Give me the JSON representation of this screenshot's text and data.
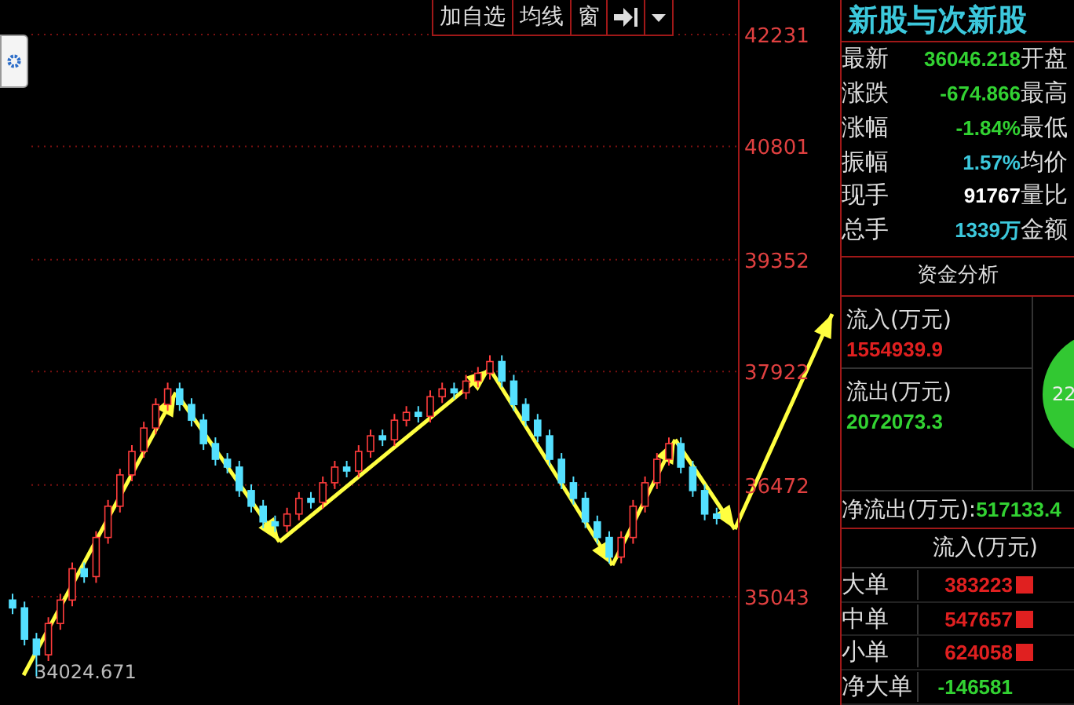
{
  "toolbar": {
    "buttons": [
      "加自选",
      "均线",
      "窗"
    ]
  },
  "chart": {
    "low_label": "34024.671",
    "chart_data": {
      "type": "candlestick",
      "grid": true,
      "ylim": [
        33658,
        42673
      ],
      "yticks": [
        42231,
        40801,
        39352,
        37922,
        36472,
        35043
      ],
      "ohlc": [
        [
          35000,
          35080,
          34820,
          34900
        ],
        [
          34900,
          34980,
          34420,
          34500
        ],
        [
          34500,
          34580,
          34024,
          34300
        ],
        [
          34300,
          34780,
          34220,
          34700
        ],
        [
          34700,
          35080,
          34620,
          35000
        ],
        [
          35000,
          35480,
          34920,
          35400
        ],
        [
          35400,
          35480,
          35220,
          35300
        ],
        [
          35300,
          35880,
          35220,
          35800
        ],
        [
          35800,
          36280,
          35720,
          36200
        ],
        [
          36200,
          36680,
          36120,
          36600
        ],
        [
          36600,
          36980,
          36520,
          36900
        ],
        [
          36900,
          37280,
          36820,
          37200
        ],
        [
          37200,
          37580,
          37120,
          37500
        ],
        [
          37500,
          37780,
          37420,
          37700
        ],
        [
          37700,
          37780,
          37420,
          37500
        ],
        [
          37500,
          37580,
          37220,
          37300
        ],
        [
          37300,
          37380,
          36920,
          37000
        ],
        [
          37000,
          37080,
          36720,
          36800
        ],
        [
          36800,
          36880,
          36620,
          36700
        ],
        [
          36700,
          36780,
          36320,
          36400
        ],
        [
          36400,
          36480,
          36120,
          36200
        ],
        [
          36200,
          36280,
          35920,
          36000
        ],
        [
          36000,
          36080,
          35870,
          35950
        ],
        [
          35950,
          36180,
          35870,
          36100
        ],
        [
          36100,
          36380,
          36020,
          36300
        ],
        [
          36300,
          36380,
          36170,
          36250
        ],
        [
          36250,
          36580,
          36170,
          36500
        ],
        [
          36500,
          36780,
          36420,
          36700
        ],
        [
          36700,
          36780,
          36570,
          36650
        ],
        [
          36650,
          36980,
          36570,
          36900
        ],
        [
          36900,
          37180,
          36820,
          37100
        ],
        [
          37100,
          37180,
          36970,
          37050
        ],
        [
          37050,
          37380,
          36970,
          37300
        ],
        [
          37300,
          37480,
          37220,
          37400
        ],
        [
          37400,
          37480,
          37270,
          37350
        ],
        [
          37350,
          37680,
          37270,
          37600
        ],
        [
          37600,
          37780,
          37520,
          37700
        ],
        [
          37700,
          37780,
          37570,
          37650
        ],
        [
          37650,
          37880,
          37570,
          37800
        ],
        [
          37800,
          37980,
          37720,
          37900
        ],
        [
          37900,
          38130,
          37820,
          38050
        ],
        [
          38050,
          38130,
          37720,
          37800
        ],
        [
          37800,
          37880,
          37420,
          37500
        ],
        [
          37500,
          37580,
          37220,
          37300
        ],
        [
          37300,
          37380,
          37020,
          37100
        ],
        [
          37100,
          37180,
          36720,
          36800
        ],
        [
          36800,
          36880,
          36420,
          36500
        ],
        [
          36500,
          36580,
          36220,
          36300
        ],
        [
          36300,
          36380,
          35920,
          36000
        ],
        [
          36000,
          36080,
          35720,
          35800
        ],
        [
          35800,
          35880,
          35470,
          35550
        ],
        [
          35550,
          35880,
          35470,
          35800
        ],
        [
          35800,
          36280,
          35720,
          36200
        ],
        [
          36200,
          36580,
          36120,
          36500
        ],
        [
          36500,
          36880,
          36420,
          36800
        ],
        [
          36800,
          37080,
          36720,
          37000
        ],
        [
          37000,
          37080,
          36620,
          36700
        ],
        [
          36700,
          36780,
          36320,
          36400
        ],
        [
          36400,
          36480,
          36020,
          36100
        ],
        [
          36100,
          36180,
          35966,
          36046
        ]
      ]
    }
  },
  "quote_panel": {
    "title": "新股与次新股",
    "rows": [
      {
        "label": "最新",
        "value": "36046.218",
        "color": "#32d232",
        "label2": "开盘"
      },
      {
        "label": "涨跌",
        "value": "-674.866",
        "color": "#32d232",
        "label2": "最高"
      },
      {
        "label": "涨幅",
        "value": "-1.84%",
        "color": "#32d232",
        "label2": "最低"
      },
      {
        "label": "振幅",
        "value": "1.57%",
        "color": "#3cc8dc",
        "label2": "均价"
      },
      {
        "label": "现手",
        "value": "91767",
        "color": "#ffffff",
        "label2": "量比"
      },
      {
        "label": "总手",
        "value": "1339万",
        "color": "#3cc8dc",
        "label2": "金额"
      }
    ]
  },
  "fund_analysis": {
    "title": "资金分析",
    "inflow": {
      "label": "流入(万元)",
      "value": "1554939.9"
    },
    "outflow": {
      "label": "流出(万元)",
      "value": "2072073.3"
    },
    "pie_label": "22",
    "net": {
      "label": "净流出(万元):",
      "value": "517133.4"
    },
    "table_title": "流入(万元)",
    "rows": [
      {
        "kind": "inflow",
        "label": "大单",
        "value": "383223",
        "color": "#e02020"
      },
      {
        "kind": "inflow",
        "label": "中单",
        "value": "547657",
        "color": "#e02020"
      },
      {
        "kind": "inflow",
        "label": "小单",
        "value": "624058",
        "color": "#e02020"
      },
      {
        "kind": "net",
        "label": "净大单",
        "value": "-146581",
        "color": "#32d232"
      }
    ]
  }
}
